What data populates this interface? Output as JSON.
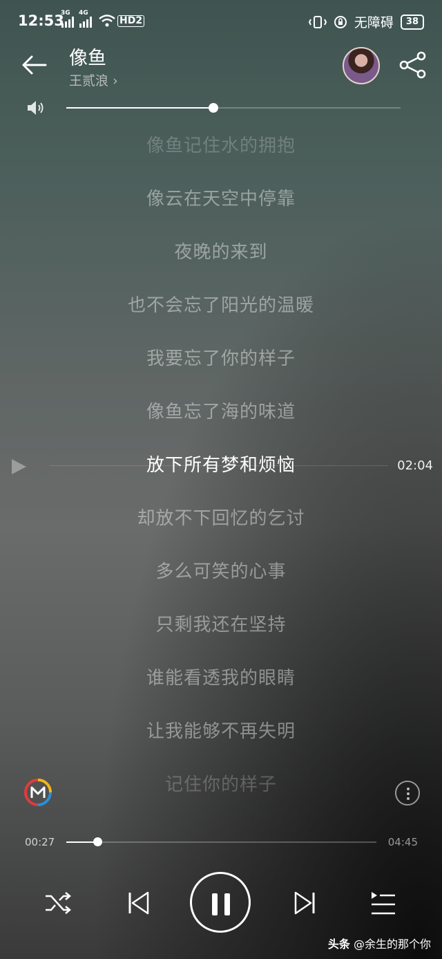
{
  "status_bar": {
    "time": "12:53",
    "signal1": "3G",
    "signal2": "4G",
    "hd": "HD2",
    "accessibility": "无障碍",
    "battery": "38"
  },
  "song": {
    "title": "像鱼",
    "artist": "王贰浪"
  },
  "volume": {
    "level": 0.44
  },
  "lyrics": [
    "像鱼记住水的拥抱",
    "像云在天空中停靠",
    "夜晚的来到",
    "也不会忘了阳光的温暖",
    "我要忘了你的样子",
    "像鱼忘了海的味道",
    "放下所有梦和烦恼",
    "却放不下回忆的乞讨",
    "多么可笑的心事",
    "只剩我还在坚持",
    "谁能看透我的眼睛",
    "让我能够不再失明",
    "记住你的样子"
  ],
  "current_lyric_index": 6,
  "seek_cursor_time": "02:04",
  "playback": {
    "current_time": "00:27",
    "total_time": "04:45",
    "progress": 0.1
  },
  "icons": {
    "back": "arrow-left-icon",
    "share": "share-icon",
    "volume": "speaker-icon",
    "shuffle": "shuffle-icon",
    "previous": "skip-previous-icon",
    "pause": "pause-icon",
    "next": "skip-next-icon",
    "playlist": "playlist-icon",
    "more": "more-vertical-icon"
  },
  "watermark": {
    "brand": "头条",
    "handle": "@余生的那个你"
  }
}
